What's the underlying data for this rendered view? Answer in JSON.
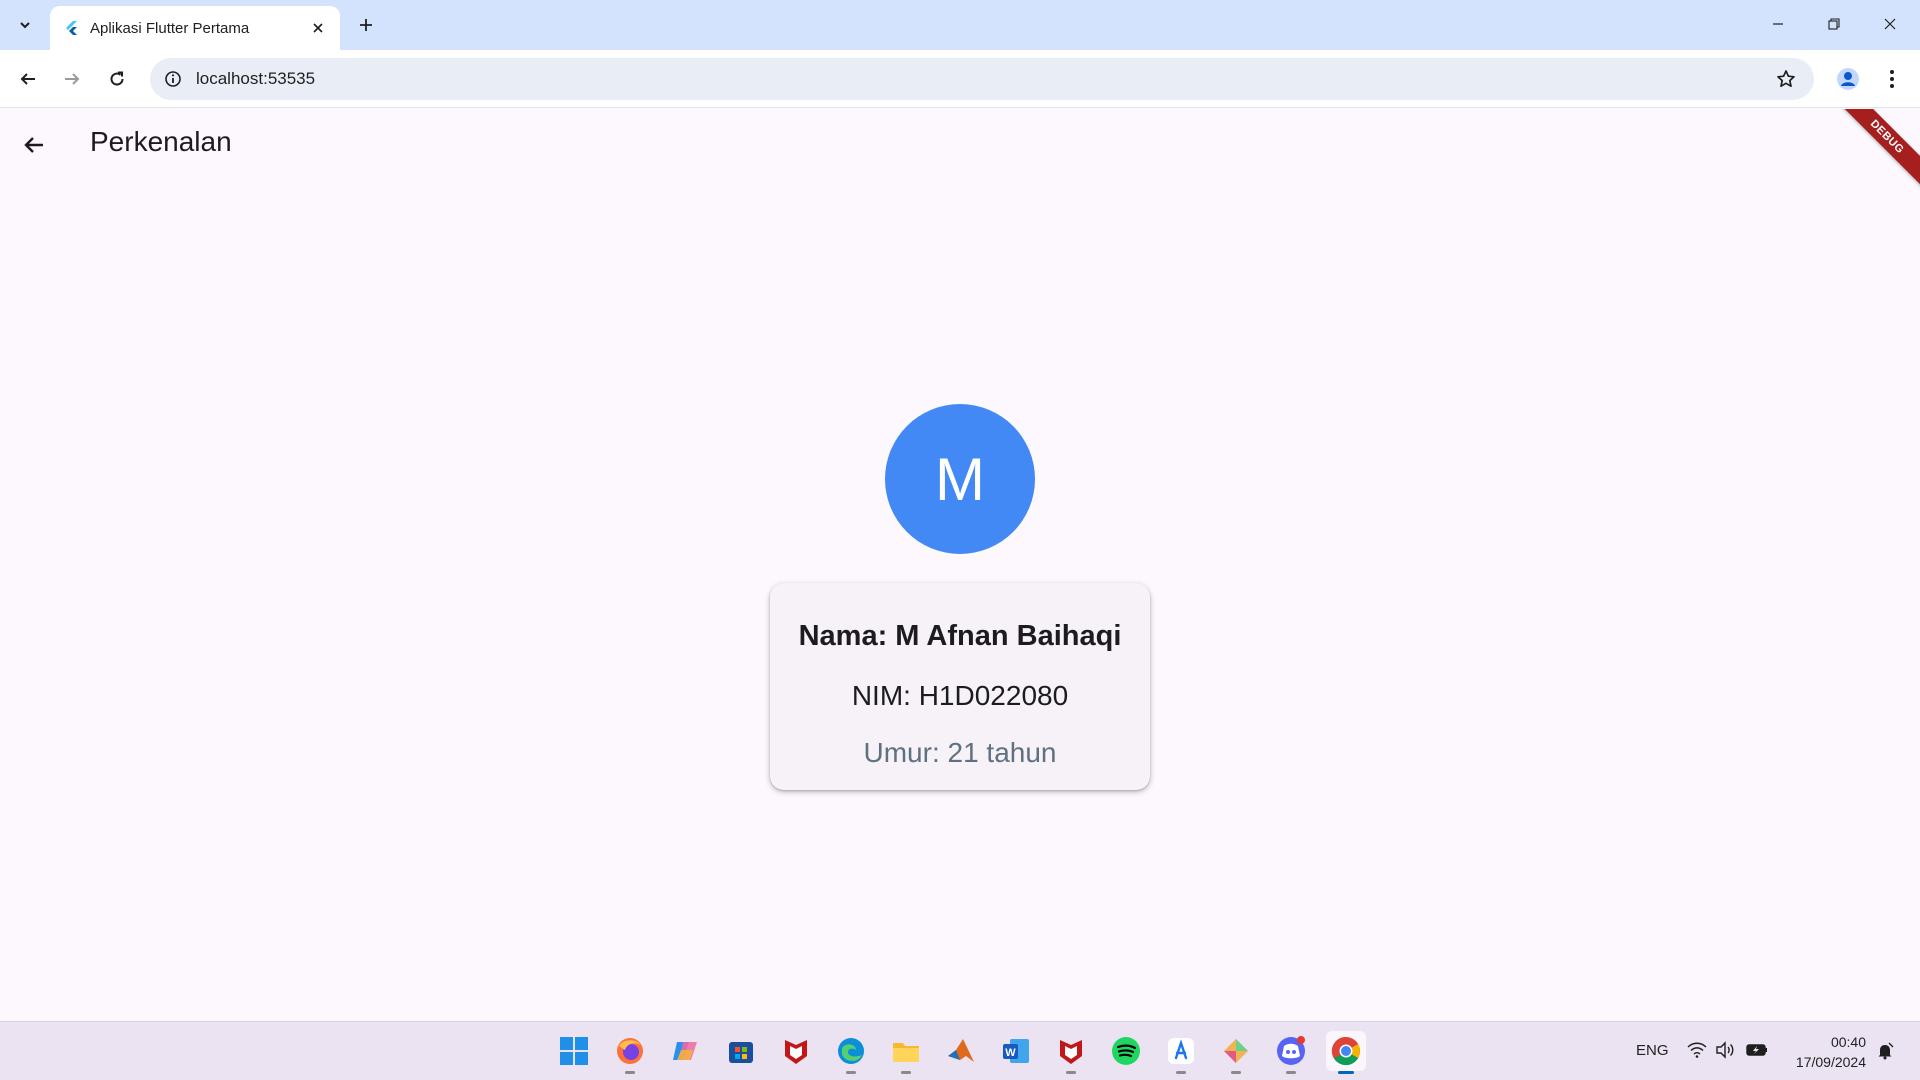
{
  "browser": {
    "tab_title": "Aplikasi Flutter Pertama",
    "url": "localhost:53535"
  },
  "app": {
    "appbar_title": "Perkenalan",
    "debug_banner": "DEBUG",
    "avatar_letter": "M",
    "avatar_color": "#4289f5",
    "card": {
      "name": "Nama: M Afnan Baihaqi",
      "nim": "NIM: H1D022080",
      "age": "Umur: 21 tahun"
    }
  },
  "taskbar": {
    "apps": [
      "start-icon",
      "firefox-icon",
      "copilot-icon",
      "store-icon",
      "mcafee-icon",
      "edge-icon",
      "file-explorer-icon",
      "matlab-icon",
      "word-icon",
      "mcafee-icon",
      "spotify-icon",
      "app-store-icon",
      "gemini-icon",
      "discord-icon",
      "chrome-icon"
    ],
    "language": "ENG",
    "time": "00:40",
    "date": "17/09/2024"
  }
}
